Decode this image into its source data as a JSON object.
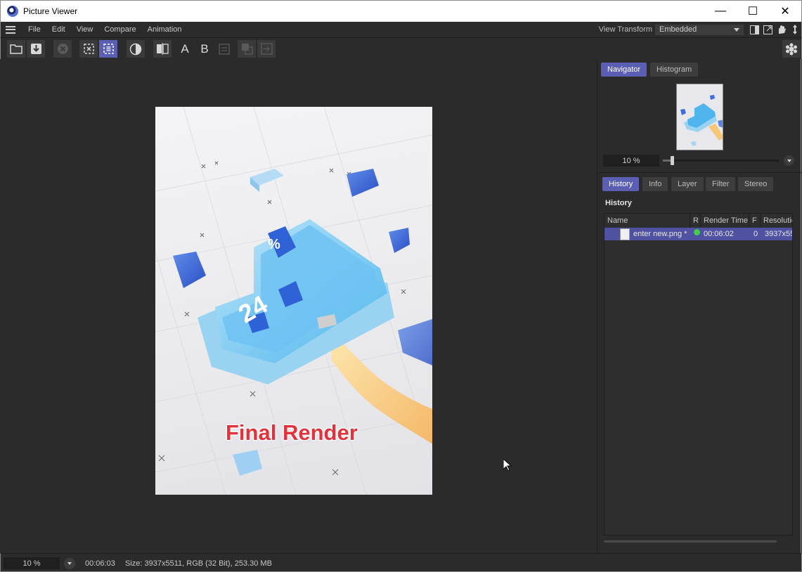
{
  "window": {
    "title": "Picture Viewer",
    "minimize_glyph": "—",
    "maximize_glyph": "☐",
    "close_glyph": "✕"
  },
  "menu": {
    "items": [
      "File",
      "Edit",
      "View",
      "Compare",
      "Animation"
    ],
    "view_transform_label": "View Transform",
    "view_transform_value": "Embedded"
  },
  "toolbar": {
    "compare_a_label": "A",
    "compare_b_label": "B"
  },
  "render": {
    "overlay_label": "Final Render",
    "accent_text_color": "#e2323b"
  },
  "navigator": {
    "tabs": [
      "Navigator",
      "Histogram"
    ],
    "active_tab": "Navigator",
    "zoom": "10 %",
    "zoom_fraction": 0.08
  },
  "history": {
    "tabs": [
      "History",
      "Info",
      "Layer",
      "Filter",
      "Stereo"
    ],
    "active_tab": "History",
    "section_title": "History",
    "columns": [
      "Name",
      "R",
      "Render Time",
      "F",
      "Resolutio"
    ],
    "rows": [
      {
        "name": "enter new.png *",
        "status_color": "#3fcf4d",
        "render_time": "00:06:02",
        "frame": "0",
        "resolution": "3937x55"
      }
    ]
  },
  "status": {
    "zoom": "10 %",
    "time": "00:06:03",
    "info": "Size: 3937x5511, RGB (32 Bit), 253.30 MB"
  },
  "colors": {
    "accent": "#5a5fb4",
    "background": "#2b2b2b"
  }
}
